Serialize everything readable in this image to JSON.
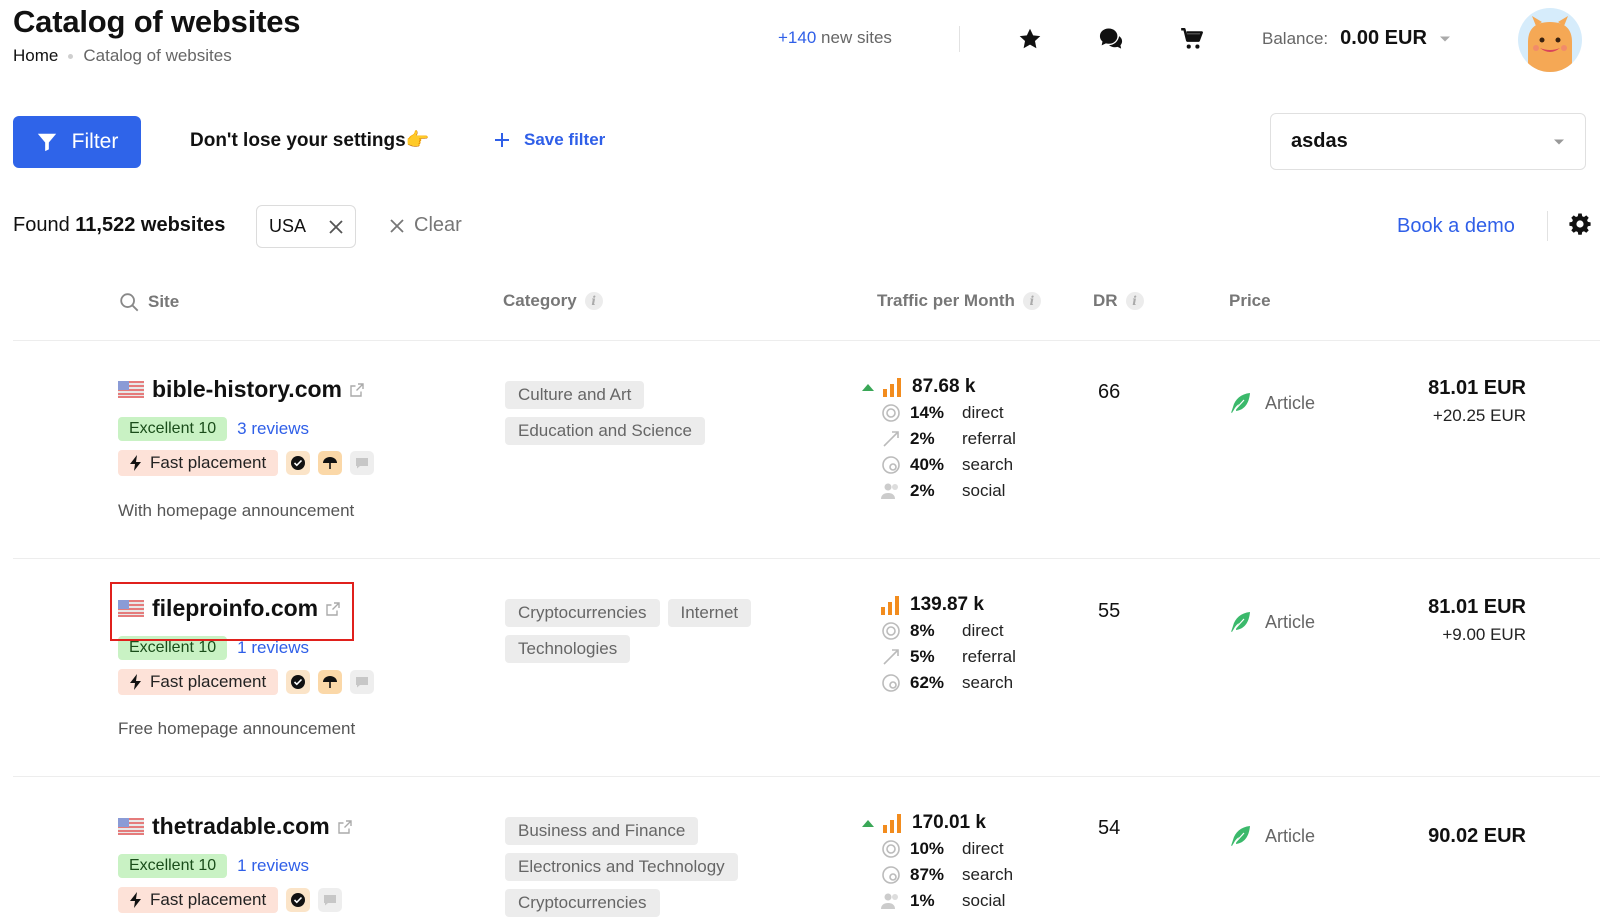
{
  "header": {
    "title": "Catalog of websites",
    "breadcrumb": {
      "home": "Home",
      "current": "Catalog of websites"
    },
    "new_sites": {
      "count": "+140",
      "label": "new sites"
    },
    "balance": {
      "label": "Balance:",
      "value": "0.00 EUR"
    },
    "icons": [
      "star-icon",
      "chat-bubbles-icon",
      "cart-icon",
      "chevron-down-icon"
    ]
  },
  "filter_bar": {
    "filter_label": "Filter",
    "hint": "Don't lose your settings👉",
    "save_filter": "Save filter",
    "saved_filter_value": "asdas"
  },
  "results": {
    "found_prefix": "Found",
    "found_count": "11,522 websites",
    "chip": "USA",
    "clear": "Clear",
    "book_demo": "Book a demo"
  },
  "table": {
    "headers": {
      "site": "Site",
      "category": "Category",
      "traffic": "Traffic per Month",
      "dr": "DR",
      "price": "Price"
    },
    "rows": [
      {
        "site": "bible-history.com",
        "rating": "Excellent 10",
        "reviews": "3 reviews",
        "fast": "Fast placement",
        "announcement": "With homepage announcement",
        "categories": [
          "Culture and Art",
          "Education and Science"
        ],
        "traffic": "87.68 k",
        "trend_up": true,
        "sources": [
          {
            "pct": "14%",
            "name": "direct"
          },
          {
            "pct": "2%",
            "name": "referral"
          },
          {
            "pct": "40%",
            "name": "search"
          },
          {
            "pct": "2%",
            "name": "social"
          }
        ],
        "dr": "66",
        "type": "Article",
        "price": "81.01 EUR",
        "price_extra": "+20.25 EUR"
      },
      {
        "site": "fileproinfo.com",
        "rating": "Excellent 10",
        "reviews": "1 reviews",
        "fast": "Fast placement",
        "announcement": "Free homepage announcement",
        "categories": [
          "Cryptocurrencies",
          "Internet",
          "Technologies"
        ],
        "traffic": "139.87 k",
        "trend_up": false,
        "sources": [
          {
            "pct": "8%",
            "name": "direct"
          },
          {
            "pct": "5%",
            "name": "referral"
          },
          {
            "pct": "62%",
            "name": "search"
          }
        ],
        "dr": "55",
        "type": "Article",
        "price": "81.01 EUR",
        "price_extra": "+9.00 EUR"
      },
      {
        "site": "thetradable.com",
        "rating": "Excellent 10",
        "reviews": "1 reviews",
        "fast": "Fast placement",
        "announcement": "",
        "categories": [
          "Business and Finance",
          "Electronics and Technology",
          "Cryptocurrencies"
        ],
        "traffic": "170.01 k",
        "trend_up": true,
        "sources": [
          {
            "pct": "10%",
            "name": "direct"
          },
          {
            "pct": "87%",
            "name": "search"
          },
          {
            "pct": "1%",
            "name": "social"
          }
        ],
        "dr": "54",
        "type": "Article",
        "price": "90.02 EUR",
        "price_extra": ""
      }
    ]
  },
  "colors": {
    "accent": "#2f64e9",
    "highlight": "#e0201c",
    "excellent_bg": "#c9f2c4",
    "fast_bg": "#fde2d8"
  }
}
